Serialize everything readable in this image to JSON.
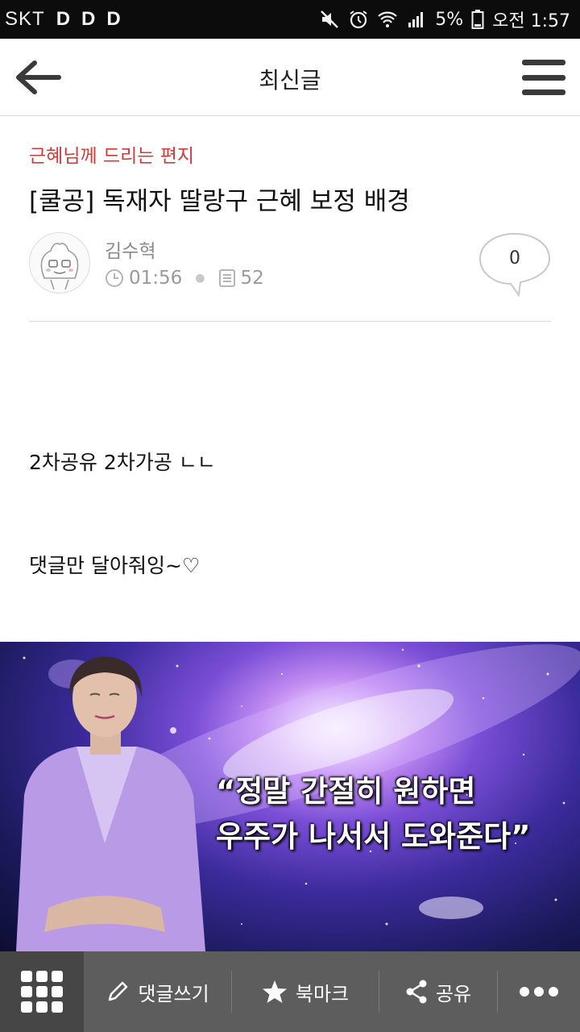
{
  "status_bar": {
    "carrier": "SKT",
    "app_badges": [
      "D",
      "D",
      "D"
    ],
    "battery_percent": "5%",
    "time": "오전 1:57",
    "icons": [
      "mute-icon",
      "alarm-icon",
      "wifi-icon",
      "signal-icon",
      "battery-icon"
    ]
  },
  "header": {
    "title": "최신글",
    "back_icon": "arrow-left-icon",
    "menu_icon": "hamburger-menu-icon"
  },
  "post": {
    "category": "근혜님께 드리는 편지",
    "title": "[쿨공] 독재자 딸랑구 근혜 보정 배경",
    "author": "김수혁",
    "time": "01:56",
    "views": "52",
    "comment_count": "0",
    "body_lines": [
      "2차공유 2차가공 ㄴㄴ",
      "댓글만 달아줘잉~♡"
    ],
    "image_caption_lines": [
      "“정말 간절히 원하면",
      "우주가 나서서 도와준다”"
    ]
  },
  "bottom_bar": {
    "grid_icon": "grid-menu-icon",
    "comment_label": "댓글쓰기",
    "bookmark_label": "북마크",
    "share_label": "공유",
    "more_icon": "more-dots-icon"
  },
  "colors": {
    "category": "#d23a3a",
    "bottom_bar": "#5d5d5d",
    "bottom_grid": "#464646",
    "status_bar": "#0c0c0c"
  }
}
